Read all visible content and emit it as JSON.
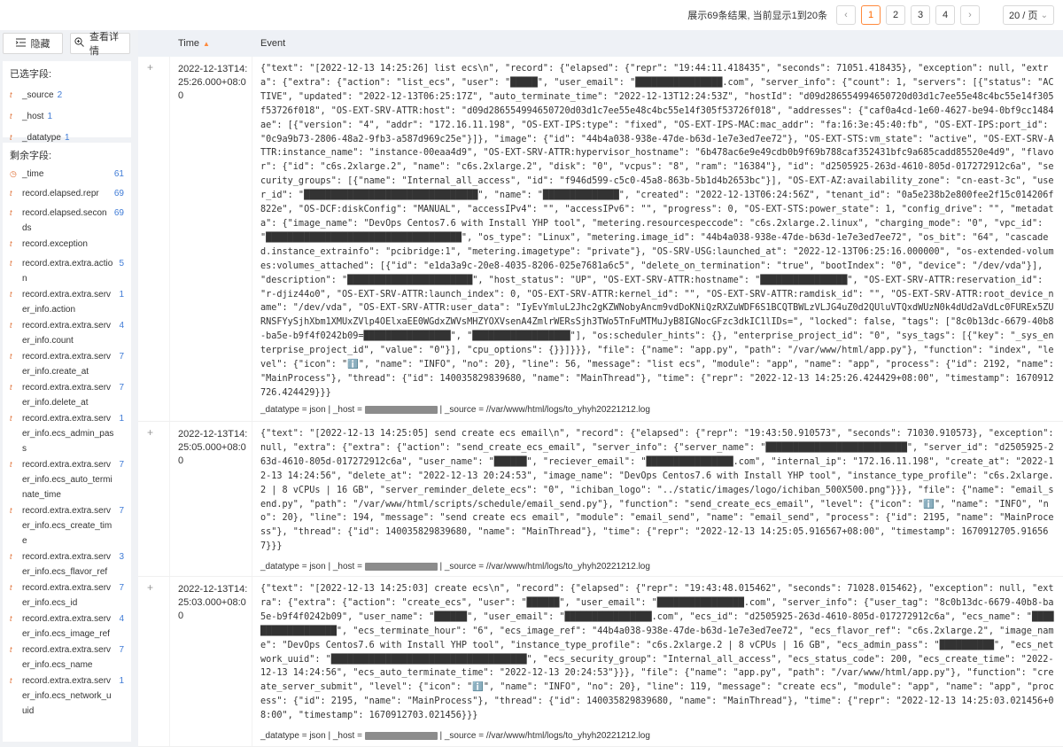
{
  "pager": {
    "summary": "展示69条结果, 当前显示1到20条",
    "prev": "‹",
    "next": "›",
    "pages": [
      "1",
      "2",
      "3",
      "4"
    ],
    "active_page": "1",
    "page_size": "20 / 页",
    "page_size_arrow": "⌄"
  },
  "sidebar": {
    "hide_label": "隐藏",
    "detail_label": "查看详情",
    "selected_title": "已选字段:",
    "selected": [
      {
        "icon": "t",
        "name": "_source",
        "count": "2"
      },
      {
        "icon": "t",
        "name": "_host",
        "count": "1"
      },
      {
        "icon": "t",
        "name": "_datatype",
        "count": "1"
      }
    ],
    "rest_title": "剩余字段:",
    "rest": [
      {
        "icon": "◷",
        "name": "_time",
        "count": "61"
      },
      {
        "icon": "t",
        "name": "record.elapsed.repr",
        "count": "69"
      },
      {
        "icon": "t",
        "name": "record.elapsed.seconds",
        "count": "69"
      },
      {
        "icon": "t",
        "name": "record.exception",
        "count": ""
      },
      {
        "icon": "t",
        "name": "record.extra.extra.action",
        "count": "5"
      },
      {
        "icon": "t",
        "name": "record.extra.extra.server_info.action",
        "count": "1"
      },
      {
        "icon": "t",
        "name": "record.extra.extra.server_info.count",
        "count": "4"
      },
      {
        "icon": "t",
        "name": "record.extra.extra.server_info.create_at",
        "count": "7"
      },
      {
        "icon": "t",
        "name": "record.extra.extra.server_info.delete_at",
        "count": "7"
      },
      {
        "icon": "t",
        "name": "record.extra.extra.server_info.ecs_admin_pass",
        "count": "1"
      },
      {
        "icon": "t",
        "name": "record.extra.extra.server_info.ecs_auto_terminate_time",
        "count": "7"
      },
      {
        "icon": "t",
        "name": "record.extra.extra.server_info.ecs_create_time",
        "count": "7"
      },
      {
        "icon": "t",
        "name": "record.extra.extra.server_info.ecs_flavor_ref",
        "count": "3"
      },
      {
        "icon": "t",
        "name": "record.extra.extra.server_info.ecs_id",
        "count": "7"
      },
      {
        "icon": "t",
        "name": "record.extra.extra.server_info.ecs_image_ref",
        "count": "4"
      },
      {
        "icon": "t",
        "name": "record.extra.extra.server_info.ecs_name",
        "count": "7"
      },
      {
        "icon": "t",
        "name": "record.extra.extra.server_info.ecs_network_uuid",
        "count": "1"
      }
    ]
  },
  "table": {
    "col_time": "Time",
    "col_event": "Event",
    "rows": [
      {
        "time": "2022-12-13T14:25:26.000+08:00",
        "event": "{\"text\": \"[2022-12-13 14:25:26] list ecs\\n\", \"record\": {\"elapsed\": {\"repr\": \"19:44:11.418435\", \"seconds\": 71051.418435}, \"exception\": null, \"extra\": {\"extra\": {\"action\": \"list_ecs\", \"user\": \"█████\", \"user_email\": \"████████████████.com\", \"server_info\": {\"count\": 1, \"servers\": [{\"status\": \"ACTIVE\", \"updated\": \"2022-12-13T06:25:17Z\", \"auto_terminate_time\": \"2022-12-13T12:24:53Z\", \"hostId\": \"d09d286554994650720d03d1c7ee55e48c4bc55e14f305f53726f018\", \"OS-EXT-SRV-ATTR:host\": \"d09d286554994650720d03d1c7ee55e48c4bc55e14f305f53726f018\", \"addresses\": {\"caf0a4cd-1e60-4627-be94-0bf9cc1484ae\": [{\"version\": \"4\", \"addr\": \"172.16.11.198\", \"OS-EXT-IPS:type\": \"fixed\", \"OS-EXT-IPS-MAC:mac_addr\": \"fa:16:3e:45:40:fb\", \"OS-EXT-IPS:port_id\": \"0c9a9b73-2806-48a2-9fb3-a587d969c25e\"}]}, \"image\": {\"id\": \"44b4a038-938e-47de-b63d-1e7e3ed7ee72\"}, \"OS-EXT-STS:vm_state\": \"active\", \"OS-EXT-SRV-ATTR:instance_name\": \"instance-00eaa4d9\", \"OS-EXT-SRV-ATTR:hypervisor_hostname\": \"6b478ac6e9e49cdb0b9f69b788caf352431bfc9a685cadd85520e4d9\", \"flavor\": {\"id\": \"c6s.2xlarge.2\", \"name\": \"c6s.2xlarge.2\", \"disk\": \"0\", \"vcpus\": \"8\", \"ram\": \"16384\"}, \"id\": \"d2505925-263d-4610-805d-017272912c6a\", \"security_groups\": [{\"name\": \"Internal_all_access\", \"id\": \"f946d599-c5c0-45a8-863b-5b1d4b2653bc\"}], \"OS-EXT-AZ:availability_zone\": \"cn-east-3c\", \"user_id\": \"████████████████████████████████\", \"name\": \"██████████████\", \"created\": \"2022-12-13T06:24:56Z\", \"tenant_id\": \"0a5e238b2e800fee2f15c014206f822e\", \"OS-DCF:diskConfig\": \"MANUAL\", \"accessIPv4\": \"\", \"accessIPv6\": \"\", \"progress\": 0, \"OS-EXT-STS:power_state\": 1, \"config_drive\": \"\", \"metadata\": {\"image_name\": \"DevOps Centos7.6 with Install YHP tool\", \"metering.resourcespeccode\": \"c6s.2xlarge.2.linux\", \"charging_mode\": \"0\", \"vpc_id\": \"████████████████████████████████████\", \"os_type\": \"Linux\", \"metering.image_id\": \"44b4a038-938e-47de-b63d-1e7e3ed7ee72\", \"os_bit\": \"64\", \"cascaded.instance_extrainfo\": \"pcibridge:1\", \"metering.imagetype\": \"private\"}, \"OS-SRV-USG:launched_at\": \"2022-12-13T06:25:16.000000\", \"os-extended-volumes:volumes_attached\": [{\"id\": \"e1da3a9c-20e8-4035-8206-025e7681a6c5\", \"delete_on_termination\": \"true\", \"bootIndex\": \"0\", \"device\": \"/dev/vda\"}], \"description\": \"███████████████████████\", \"host_status\": \"UP\", \"OS-EXT-SRV-ATTR:hostname\": \"████████████████\", \"OS-EXT-SRV-ATTR:reservation_id\": \"r-djiz44o0\", \"OS-EXT-SRV-ATTR:launch_index\": 0, \"OS-EXT-SRV-ATTR:kernel_id\": \"\", \"OS-EXT-SRV-ATTR:ramdisk_id\": \"\", \"OS-EXT-SRV-ATTR:root_device_name\": \"/dev/vda\", \"OS-EXT-SRV-ATTR:user_data\": \"IyEvYmluL2Jhc2gKZWNobyAncm9vdDoKNiQzRXZuWDF6S1BCQTBWLzVLJG4uZ0d2QUluVTQxdWUzN0k4dUd2aVdLc0FUREx5ZURNSFYySjhXbm1XMUxZVlp4OElxaEE0WGdxZWVsMHZYOXVsenA4ZmlrWERsSjh3TWo5TnFuMTMuJyB8IGNocGFzc3dkIC1lIDs=\", \"locked\": false, \"tags\": [\"8c0b13dc-6679-40b8-ba5e-b9f4f0242b09=████████████████\", \"██████████████████\"], \"os:scheduler_hints\": {}, \"enterprise_project_id\": \"0\", \"sys_tags\": [{\"key\": \"_sys_enterprise_project_id\", \"value\": \"0\"}], \"cpu_options\": {}}]}}}, \"file\": {\"name\": \"app.py\", \"path\": \"/var/www/html/app.py\"}, \"function\": \"index\", \"level\": {\"icon\": \"ℹ️\", \"name\": \"INFO\", \"no\": 20}, \"line\": 56, \"message\": \"list ecs\", \"module\": \"app\", \"name\": \"app\", \"process\": {\"id\": 2192, \"name\": \"MainProcess\"}, \"thread\": {\"id\": 140035829839680, \"name\": \"MainThread\"}, \"time\": {\"repr\": \"2022-12-13 14:25:26.424429+08:00\", \"timestamp\": 1670912726.424429}}}",
        "meta_prefix": "_datatype = json | _host = ",
        "meta_suffix": " | _source = //var/www/html/logs/to_yhyh20221212.log"
      },
      {
        "time": "2022-12-13T14:25:05.000+08:00",
        "event": "{\"text\": \"[2022-12-13 14:25:05] send create ecs email\\n\", \"record\": {\"elapsed\": {\"repr\": \"19:43:50.910573\", \"seconds\": 71030.910573}, \"exception\": null, \"extra\": {\"extra\": {\"action\": \"send_create_ecs_email\", \"server_info\": {\"server_name\": \"██████████████████████████\", \"server_id\": \"d2505925-263d-4610-805d-017272912c6a\", \"user_name\": \"██████\", \"reciever_email\": \"████████████████.com\", \"internal_ip\": \"172.16.11.198\", \"create_at\": \"2022-12-13 14:24:56\", \"delete_at\": \"2022-12-13 20:24:53\", \"image_name\": \"DevOps Centos7.6 with Install YHP tool\", \"instance_type_profile\": \"c6s.2xlarge.2 | 8 vCPUs | 16 GB\", \"server_reminder_delete_ecs\": \"0\", \"ichiban_logo\": \"../static/images/logo/ichiban_500X500.png\"}}}, \"file\": {\"name\": \"email_send.py\", \"path\": \"/var/www/html/scripts/schedule/email_send.py\"}, \"function\": \"send_create_ecs_email\", \"level\": {\"icon\": \"ℹ️\", \"name\": \"INFO\", \"no\": 20}, \"line\": 194, \"message\": \"send create ecs email\", \"module\": \"email_send\", \"name\": \"email_send\", \"process\": {\"id\": 2195, \"name\": \"MainProcess\"}, \"thread\": {\"id\": 140035829839680, \"name\": \"MainThread\"}, \"time\": {\"repr\": \"2022-12-13 14:25:05.916567+08:00\", \"timestamp\": 1670912705.916567}}}",
        "meta_prefix": "_datatype = json | _host = ",
        "meta_suffix": " | _source = //var/www/html/logs/to_yhyh20221212.log"
      },
      {
        "time": "2022-12-13T14:25:03.000+08:00",
        "event": "{\"text\": \"[2022-12-13 14:25:03] create ecs\\n\", \"record\": {\"elapsed\": {\"repr\": \"19:43:48.015462\", \"seconds\": 71028.015462}, \"exception\": null, \"extra\": {\"extra\": {\"action\": \"create_ecs\", \"user\": \"██████\", \"user_email\": \"████████████████.com\", \"server_info\": {\"user_tag\": \"8c0b13dc-6679-40b8-ba5e-b9f4f0242b09\", \"user_name\": \"██████\", \"user_email\": \"████████████████.com\", \"ecs_id\": \"d2505925-263d-4610-805d-017272912c6a\", \"ecs_name\": \"██████████████████\", \"ecs_terminate_hour\": \"6\", \"ecs_image_ref\": \"44b4a038-938e-47de-b63d-1e7e3ed7ee72\", \"ecs_flavor_ref\": \"c6s.2xlarge.2\", \"image_name\": \"DevOps Centos7.6 with Install YHP tool\", \"instance_type_profile\": \"c6s.2xlarge.2 | 8 vCPUs | 16 GB\", \"ecs_admin_pass\": \"██████████\", \"ecs_network_uuid\": \"████████████████████████████████████\", \"ecs_security_group\": \"Internal_all_access\", \"ecs_status_code\": 200, \"ecs_create_time\": \"2022-12-13 14:24:56\", \"ecs_auto_terminate_time\": \"2022-12-13 20:24:53\"}}}, \"file\": {\"name\": \"app.py\", \"path\": \"/var/www/html/app.py\"}, \"function\": \"create_server_submit\", \"level\": {\"icon\": \"ℹ️\", \"name\": \"INFO\", \"no\": 20}, \"line\": 119, \"message\": \"create ecs\", \"module\": \"app\", \"name\": \"app\", \"process\": {\"id\": 2195, \"name\": \"MainProcess\"}, \"thread\": {\"id\": 140035829839680, \"name\": \"MainThread\"}, \"time\": {\"repr\": \"2022-12-13 14:25:03.021456+08:00\", \"timestamp\": 1670912703.021456}}}",
        "meta_prefix": "_datatype = json | _host = ",
        "meta_suffix": " | _source = //var/www/html/logs/to_yhyh20221212.log"
      }
    ]
  },
  "colors": {
    "accent": "#ff6a00",
    "field_icon": "#e0733a",
    "count": "#3f7bd6"
  }
}
